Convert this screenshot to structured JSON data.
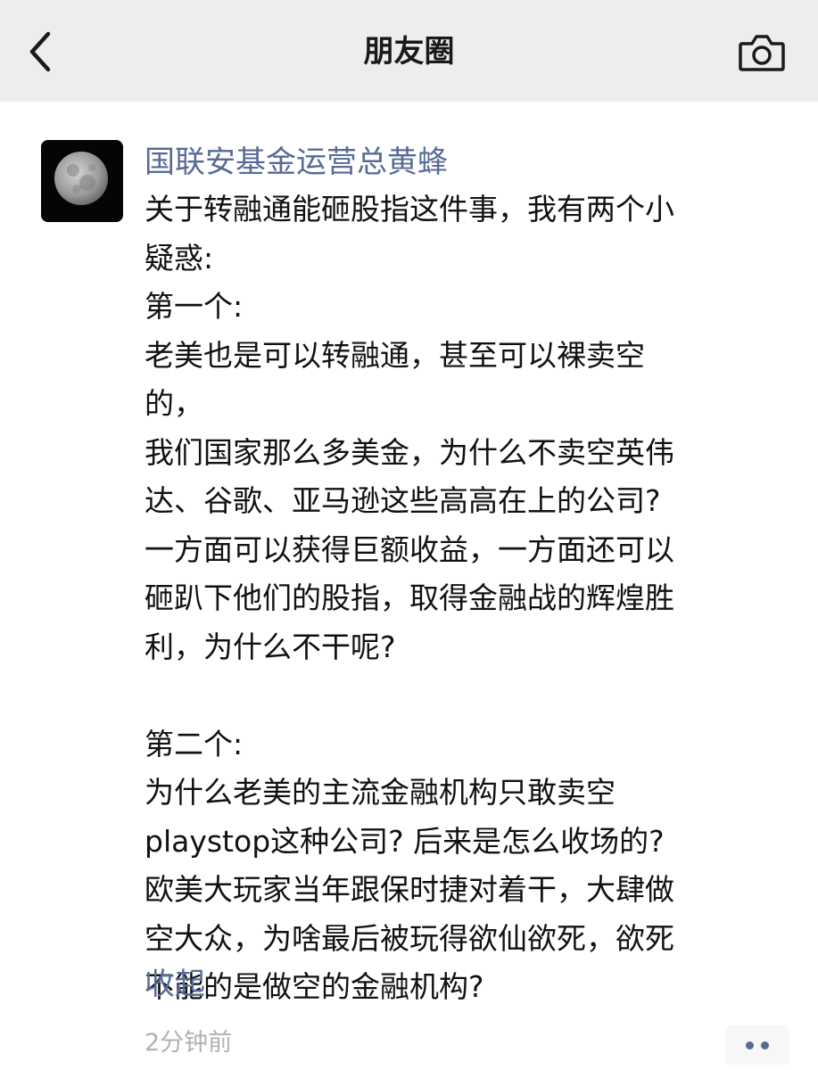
{
  "header": {
    "title": "朋友圈"
  },
  "post": {
    "author": "国联安基金运营总黄蜂",
    "lines": [
      "关于转融通能砸股指这件事，我有两个小",
      "疑惑:",
      "第一个:",
      "老美也是可以转融通，甚至可以裸卖空",
      "的，",
      "我们国家那么多美金，为什么不卖空英伟",
      "达、谷歌、亚马逊这些高高在上的公司?",
      "一方面可以获得巨额收益，一方面还可以",
      "砸趴下他们的股指，取得金融战的辉煌胜",
      "利，为什么不干呢?",
      "",
      "第二个:",
      "为什么老美的主流金融机构只敢卖空",
      "playstop这种公司? 后来是怎么收场的?",
      "欧美大玩家当年跟保时捷对着干，大肆做",
      "空大众，为啥最后被玩得欲仙欲死，欲死",
      "不能的是做空的金融机构?"
    ],
    "collapse_label": "收起",
    "timestamp": "2分钟前"
  },
  "icons": {
    "back": "chevron-left-icon",
    "camera": "camera-icon",
    "more": "more-dots-icon"
  },
  "colors": {
    "link": "#576b95",
    "header_bg": "#ededed",
    "timestamp": "#b2b2b2"
  }
}
